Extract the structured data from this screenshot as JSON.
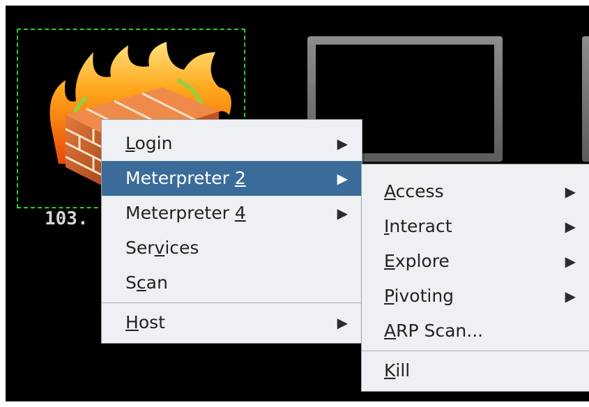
{
  "host": {
    "label": "103."
  },
  "context_menu": {
    "items": [
      {
        "pre": "",
        "ul": "L",
        "post": "ogin",
        "submenu": true,
        "active": false
      },
      {
        "pre": "Meterpreter ",
        "ul": "2",
        "post": "",
        "submenu": true,
        "active": true
      },
      {
        "pre": "Meterpreter ",
        "ul": "4",
        "post": "",
        "submenu": true,
        "active": false
      },
      {
        "pre": "Ser",
        "ul": "v",
        "post": "ices",
        "submenu": false,
        "active": false
      },
      {
        "pre": "S",
        "ul": "c",
        "post": "an",
        "submenu": false,
        "active": false
      },
      {
        "pre": "",
        "ul": "H",
        "post": "ost",
        "submenu": true,
        "active": false
      }
    ]
  },
  "submenu": {
    "items": [
      {
        "pre": "",
        "ul": "A",
        "post": "ccess",
        "submenu": true
      },
      {
        "pre": "",
        "ul": "I",
        "post": "nteract",
        "submenu": true
      },
      {
        "pre": "",
        "ul": "E",
        "post": "xplore",
        "submenu": true
      },
      {
        "pre": "",
        "ul": "P",
        "post": "ivoting",
        "submenu": true
      },
      {
        "pre": "",
        "ul": "A",
        "post": "RP Scan...",
        "submenu": false
      },
      {
        "pre": "",
        "ul": "K",
        "post": "ill",
        "submenu": false
      }
    ]
  },
  "icons": {
    "submenu_arrow": "▶",
    "host": "firewall-icon",
    "target": "monitor-icon"
  },
  "colors": {
    "highlight": "#3b6c99",
    "selection_border": "#2ecc2e",
    "menu_bg": "#eef0f3"
  }
}
